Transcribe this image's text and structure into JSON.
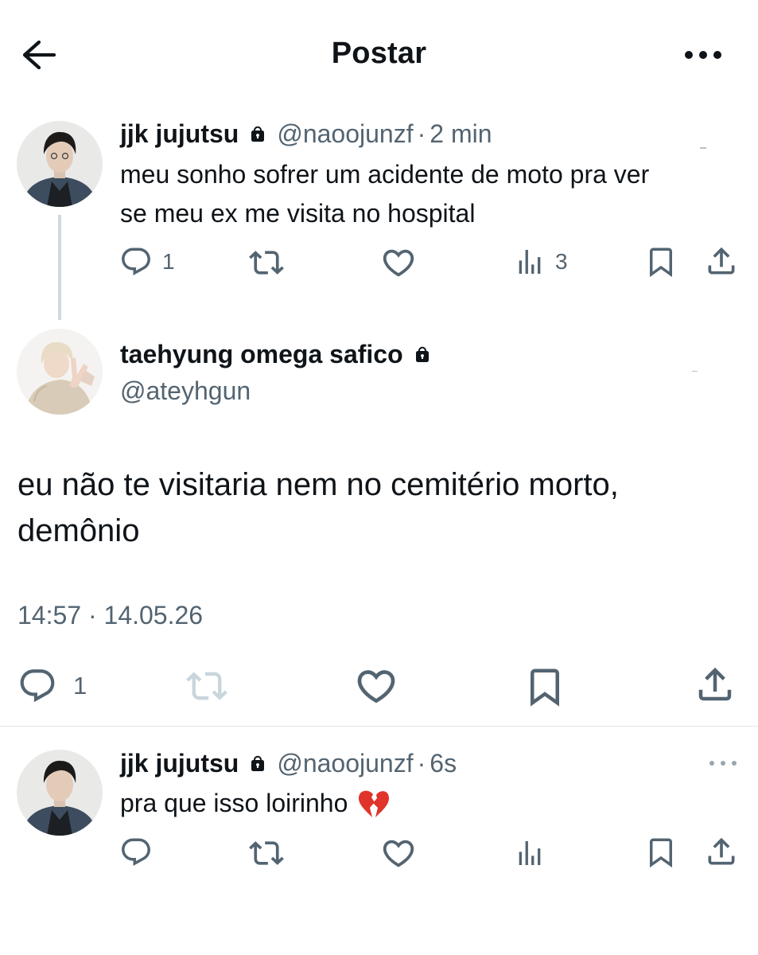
{
  "header": {
    "title": "Postar"
  },
  "parent_post": {
    "name": "jjk jujutsu",
    "handle": "@naoojunzf",
    "separator": "·",
    "time": "2 min",
    "text_line1": "meu sonho sofrer um acidente de moto pra ver",
    "text_line2": "se meu ex me visita no hospital",
    "reply_count": "1",
    "views_count": "3"
  },
  "main_post": {
    "name": "taehyung omega safico",
    "handle": "@ateyhgun",
    "text_line1": "eu não te visitaria nem no cemitério morto,",
    "text_line2": "demônio",
    "timestamp": "14:57 · 14.05.26",
    "reply_count": "1"
  },
  "reply_post": {
    "name": "jjk jujutsu",
    "handle": "@naoojunzf",
    "separator": "·",
    "time": "6s",
    "text": "pra que isso loirinho",
    "emoji": "💔"
  },
  "icons": {
    "back": "arrow-left-icon",
    "more": "more-horizontal-icon",
    "lock": "lock-icon",
    "reply": "speech-bubble-icon",
    "repost": "repost-icon",
    "like": "heart-icon",
    "views": "bar-chart-icon",
    "bookmark": "bookmark-icon",
    "share": "share-upload-icon"
  },
  "colors": {
    "text": "#0f1419",
    "secondary": "#536471",
    "line": "#cfd9de",
    "disabled_repost": "#c9d5dc",
    "broken_heart": "#e0342b"
  }
}
